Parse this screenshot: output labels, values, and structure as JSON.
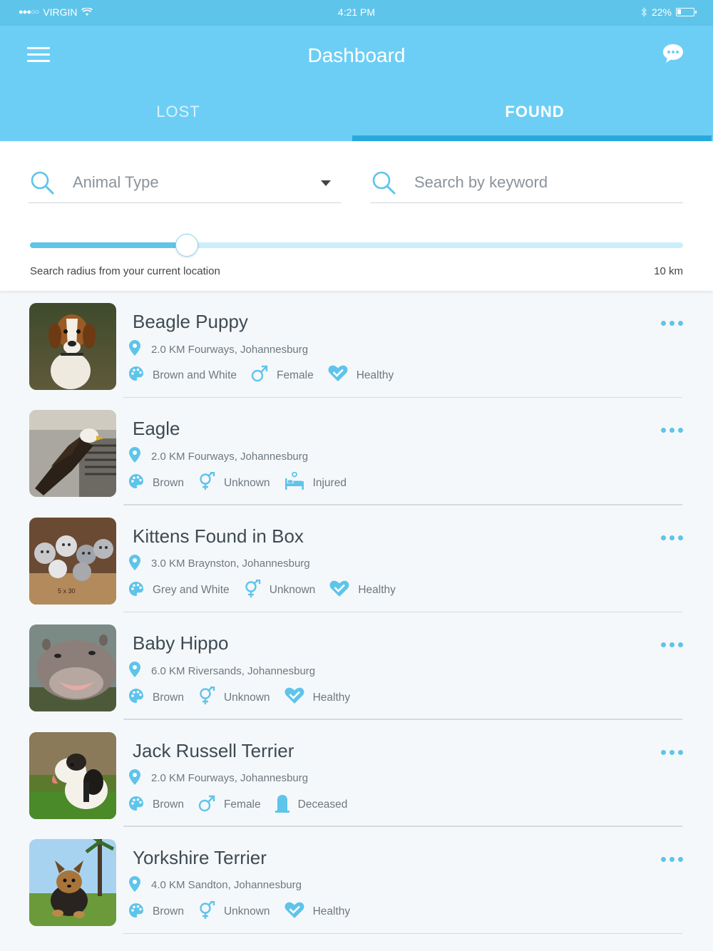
{
  "status_bar": {
    "carrier": "VIRGIN",
    "time": "4:21 PM",
    "battery": "22%"
  },
  "header": {
    "title": "Dashboard"
  },
  "tabs": [
    {
      "label": "LOST",
      "active": false
    },
    {
      "label": "FOUND",
      "active": true
    }
  ],
  "filters": {
    "animal_type_label": "Animal Type",
    "keyword_placeholder": "Search by keyword",
    "radius_label": "Search radius from your current location",
    "radius_value": "10 km",
    "radius_fraction": 0.24
  },
  "colors": {
    "accent": "#6dcef5",
    "accent_dark": "#2aa8dc",
    "icon": "#5ec4ea"
  },
  "listings": [
    {
      "name": "Beagle Puppy",
      "location": "2.0 KM Fourways, Johannesburg",
      "color": "Brown and White",
      "sex": "Female",
      "sex_icon": "male-symbol-icon",
      "status": "Healthy",
      "status_icon": "heart-check-icon",
      "photo": "beagle-photo"
    },
    {
      "name": "Eagle",
      "location": "2.0 KM Fourways, Johannesburg",
      "color": "Brown",
      "sex": "Unknown",
      "sex_icon": "unknown-sex-icon",
      "status": "Injured",
      "status_icon": "hospital-bed-icon",
      "photo": "eagle-photo"
    },
    {
      "name": "Kittens Found in Box",
      "location": "3.0 KM Braynston, Johannesburg",
      "color": "Grey and White",
      "sex": "Unknown",
      "sex_icon": "unknown-sex-icon",
      "status": "Healthy",
      "status_icon": "heart-check-icon",
      "photo": "kittens-photo"
    },
    {
      "name": "Baby Hippo",
      "location": "6.0 KM Riversands, Johannesburg",
      "color": "Brown",
      "sex": "Unknown",
      "sex_icon": "unknown-sex-icon",
      "status": "Healthy",
      "status_icon": "heart-check-icon",
      "photo": "hippo-photo"
    },
    {
      "name": "Jack Russell Terrier",
      "location": "2.0 KM Fourways, Johannesburg",
      "color": "Brown",
      "sex": "Female",
      "sex_icon": "male-symbol-icon",
      "status": "Deceased",
      "status_icon": "tombstone-icon",
      "photo": "terrier-photo"
    },
    {
      "name": "Yorkshire Terrier",
      "location": "4.0 KM Sandton, Johannesburg",
      "color": "Brown",
      "sex": "Unknown",
      "sex_icon": "unknown-sex-icon",
      "status": "Healthy",
      "status_icon": "heart-check-icon",
      "photo": "yorkie-photo"
    }
  ]
}
